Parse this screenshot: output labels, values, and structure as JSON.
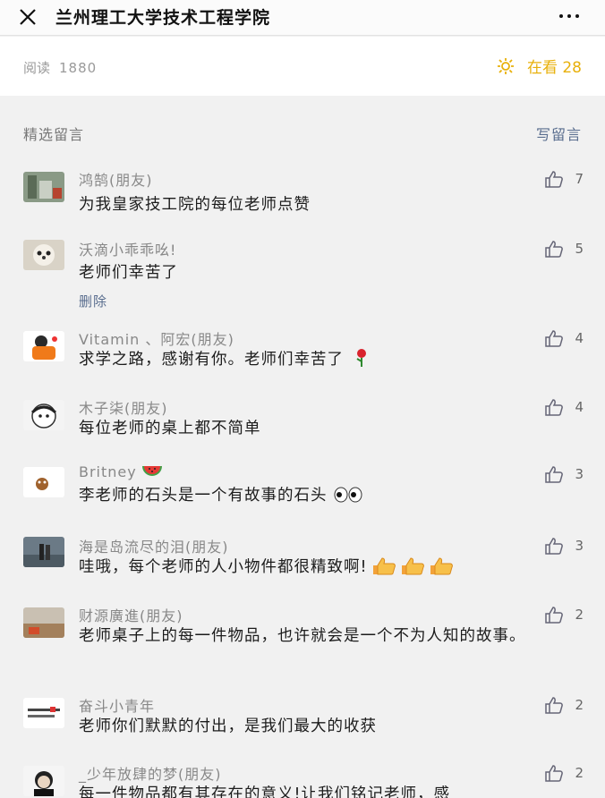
{
  "header": {
    "title": "兰州理工大学技术工程学院"
  },
  "stats": {
    "read_label": "阅读",
    "read_count": "1880",
    "looking_label": "在看",
    "looking_count": "28"
  },
  "section": {
    "selected_label": "精选留言",
    "write_label": "写留言"
  },
  "comments": [
    {
      "nick": "鸿鹄(朋友)",
      "text": "为我皇家技工院的每位老师点赞",
      "likes": "7"
    },
    {
      "nick": "沃滴小乖乖吆!",
      "text": "老师们幸苦了",
      "likes": "5",
      "delete_label": "删除"
    },
    {
      "nick": "Vitamin 、阿宏(朋友)",
      "text": "求学之路，感谢有你。老师们幸苦了",
      "likes": "4"
    },
    {
      "nick": "木子柒(朋友)",
      "text": "每位老师的桌上都不简单",
      "likes": "4"
    },
    {
      "nick": "Britney",
      "text": "李老师的石头是一个有故事的石头",
      "likes": "3"
    },
    {
      "nick": "海是岛流尽的泪(朋友)",
      "text": "哇哦，每个老师的人小物件都很精致啊!",
      "likes": "3"
    },
    {
      "nick": "财源廣進(朋友)",
      "text": "老师桌子上的每一件物品，也许就会是一个不为人知的故事。",
      "likes": "2"
    },
    {
      "nick": "奋斗小青年",
      "text": "老师你们默默的付出，是我们最大的收获",
      "likes": "2"
    },
    {
      "nick": "_少年放肆的梦(朋友)",
      "text": "每一件物品都有其存在的意义!让我们铭记老师，感",
      "likes": "2"
    }
  ],
  "colors": {
    "accent_yellow": "#e8b00a",
    "link_blue": "#5a6e8f",
    "background": "#f1f1f1"
  }
}
